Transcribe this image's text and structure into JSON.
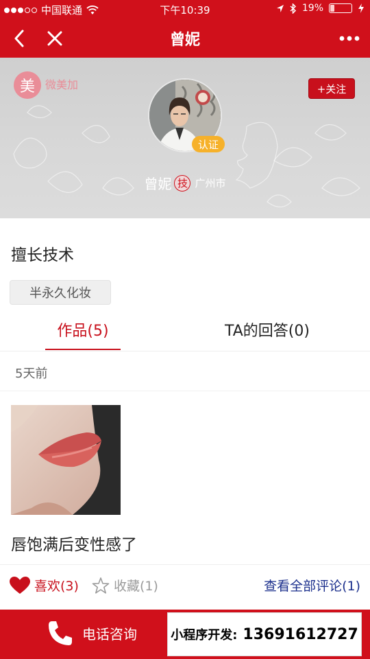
{
  "status_bar": {
    "carrier": "中国联通",
    "time": "下午10:39",
    "battery": "19%"
  },
  "navbar": {
    "title": "曾妮"
  },
  "profile": {
    "logo_mark": "美",
    "logo_text": "微美加",
    "follow_label": "+关注",
    "verified_label": "认证",
    "name": "曾妮",
    "tech_badge": "技",
    "city": "广州市"
  },
  "skills": {
    "title": "擅长技术",
    "tags": [
      "半永久化妆"
    ]
  },
  "tabs": [
    {
      "label": "作品(5)",
      "active": true
    },
    {
      "label": "TA的回答(0)",
      "active": false
    }
  ],
  "post": {
    "time": "5天前",
    "caption": "唇饱满后变性感了",
    "like_label": "喜欢(3)",
    "favorite_label": "收藏(1)",
    "comments_label": "查看全部评论(1)"
  },
  "bottom_bar": {
    "call_label": "电话咨询",
    "dev_label": "小程序开发:",
    "dev_phone": "13691612727"
  },
  "colors": {
    "brand_red": "#d0101b",
    "accent_red": "#c8101c",
    "link_blue": "#1b2f8c",
    "verify_orange": "#f6b12a",
    "logo_pink": "#e98d98"
  }
}
